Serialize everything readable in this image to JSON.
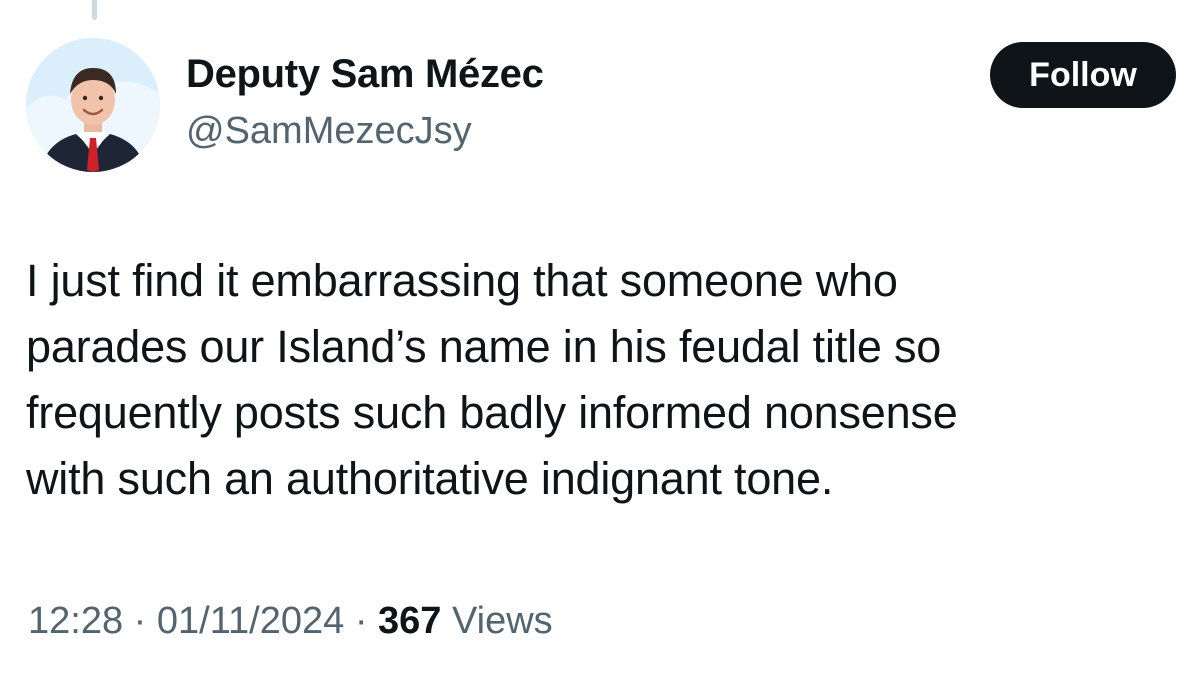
{
  "author": {
    "display_name": "Deputy Sam Mézec",
    "handle": "@SamMezecJsy"
  },
  "follow_button": {
    "label": "Follow"
  },
  "tweet": {
    "lines": [
      "I just find it embarrassing that someone who",
      "parades our Island’s name in his feudal title so",
      "frequently posts such badly informed nonsense",
      "with such an authoritative indignant tone."
    ]
  },
  "meta": {
    "time": "12:28",
    "separator": "·",
    "date": "01/11/2024",
    "views_count": "367",
    "views_label": "Views"
  },
  "colors": {
    "text_primary": "#0f1419",
    "text_secondary": "#536471",
    "button_bg": "#0f1419",
    "button_text": "#ffffff",
    "background": "#ffffff"
  }
}
